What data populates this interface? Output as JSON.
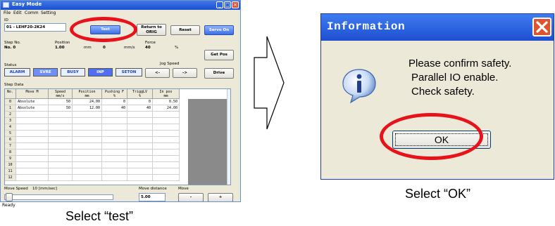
{
  "easy_mode": {
    "title": "Easy Mode",
    "menu": [
      "File",
      "Edit",
      "Comm",
      "Setting"
    ],
    "id_label": "ID",
    "id_value": "01 - LEHF20-2K24",
    "buttons": {
      "test": "Test",
      "return_to_origin": "Return to ORIG",
      "reset": "Reset",
      "servo_on": "Servo On",
      "get_pos": "Get Pos",
      "drive": "Drive",
      "jog_minus": "<-",
      "jog_plus": "->",
      "move_minus": "-",
      "move_plus": "+"
    },
    "step_no_label": "Step No.",
    "step_no_value": "No. 0",
    "position_label": "Position",
    "position_value": "1.00",
    "position_unit": "mm",
    "speed_value": "0",
    "speed_unit": "mm/s",
    "force_label": "Force",
    "force_value": "40",
    "force_unit": "%",
    "status_label": "Status",
    "status_flags": [
      "ALARM",
      "SVRE",
      "BUSY",
      "INP",
      "SETON"
    ],
    "jog_speed_label": "Jog Speed",
    "step_data_label": "Step Data",
    "table": {
      "headers": [
        "No.",
        "Move M",
        "Speed\nmm/s",
        "Position\nmm",
        "Pushing F\n%",
        "TriggLV\n%",
        "In pos\nmm"
      ],
      "rows": [
        [
          "0",
          "Absolute",
          "50",
          "24.00",
          "0",
          "0",
          "0.50"
        ],
        [
          "1",
          "Absolute",
          "50",
          "12.00",
          "40",
          "40",
          "24.00"
        ],
        [
          "2",
          "",
          "",
          "",
          "",
          "",
          ""
        ],
        [
          "3",
          "",
          "",
          "",
          "",
          "",
          ""
        ],
        [
          "4",
          "",
          "",
          "",
          "",
          "",
          ""
        ],
        [
          "5",
          "",
          "",
          "",
          "",
          "",
          ""
        ],
        [
          "6",
          "",
          "",
          "",
          "",
          "",
          ""
        ],
        [
          "7",
          "",
          "",
          "",
          "",
          "",
          ""
        ],
        [
          "8",
          "",
          "",
          "",
          "",
          "",
          ""
        ],
        [
          "9",
          "",
          "",
          "",
          "",
          "",
          ""
        ],
        [
          "10",
          "",
          "",
          "",
          "",
          "",
          ""
        ],
        [
          "11",
          "",
          "",
          "",
          "",
          "",
          ""
        ],
        [
          "12",
          "",
          "",
          "",
          "",
          "",
          ""
        ]
      ]
    },
    "move_speed_label": "Move Speed",
    "move_speed_value": "10 [mm/sec]",
    "move_distance_label": "Move distance",
    "move_distance_value": "5.00",
    "move_label": "Move",
    "status_bar": "Ready"
  },
  "dialog": {
    "title": "Information",
    "message_lines": [
      "Please confirm safety.",
      "Parallel IO enable.",
      "Check safety."
    ],
    "ok_label": "OK"
  },
  "captions": {
    "left": "Select “test”",
    "right": "Select “OK”"
  },
  "colors": {
    "highlight_ring": "#e8121a",
    "titlebar_blue": "#1d4ed0",
    "close_red": "#e0532f"
  }
}
